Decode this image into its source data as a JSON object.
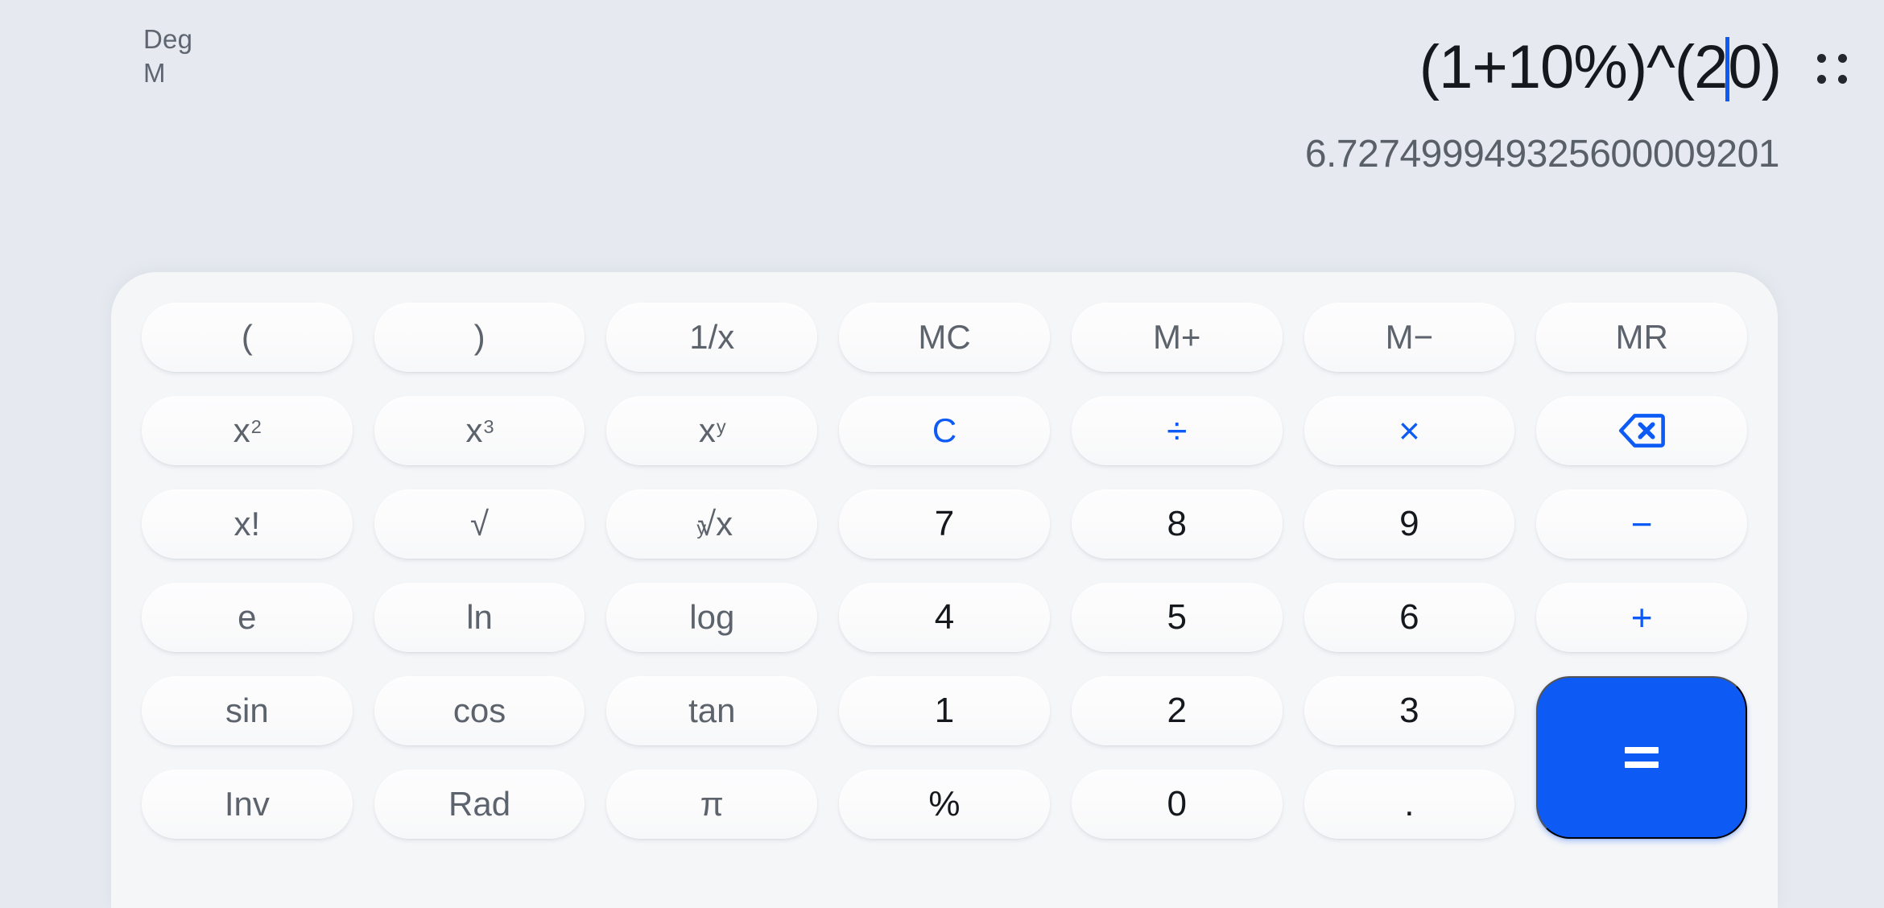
{
  "display": {
    "mode_indicators": [
      {
        "name": "angle-mode",
        "label": "Deg"
      },
      {
        "name": "memory-indicator",
        "label": "M"
      }
    ],
    "expression": "(1+10%)^(20)",
    "expression_before_cursor": "(1+10%)^(2",
    "expression_after_cursor": "0)",
    "cursor_visible": true,
    "result": "6.727499949325600009201",
    "grip_icon": "drag-grip-icon"
  },
  "colors": {
    "background": "#e6eaf0",
    "keypad_panel": "#f5f6f8",
    "accent": "#0d5af5",
    "key_face": "#fbfbfc",
    "key_text": "#5d636c",
    "digit_text": "#15181c",
    "result_text": "#5a6068"
  },
  "keypad": {
    "rows": [
      [
        {
          "name": "key-open-paren",
          "label": "(",
          "type": "function"
        },
        {
          "name": "key-close-paren",
          "label": ")",
          "type": "function"
        },
        {
          "name": "key-reciprocal",
          "label": "1/x",
          "type": "function"
        },
        {
          "name": "key-memory-clear",
          "label": "MC",
          "type": "function"
        },
        {
          "name": "key-memory-add",
          "label": "M+",
          "type": "function"
        },
        {
          "name": "key-memory-subtract",
          "label": "M−",
          "type": "function"
        },
        {
          "name": "key-memory-recall",
          "label": "MR",
          "type": "function"
        }
      ],
      [
        {
          "name": "key-square",
          "label": "x²",
          "type": "function"
        },
        {
          "name": "key-cube",
          "label": "x³",
          "type": "function"
        },
        {
          "name": "key-power",
          "label": "xʸ",
          "type": "function"
        },
        {
          "name": "key-clear",
          "label": "C",
          "type": "accent"
        },
        {
          "name": "key-divide",
          "label": "÷",
          "type": "accent-op"
        },
        {
          "name": "key-multiply",
          "label": "×",
          "type": "accent-op"
        },
        {
          "name": "key-backspace",
          "label": "",
          "type": "icon",
          "icon": "backspace-icon"
        }
      ],
      [
        {
          "name": "key-factorial",
          "label": "x!",
          "type": "function"
        },
        {
          "name": "key-square-root",
          "label": "√",
          "type": "function"
        },
        {
          "name": "key-nth-root",
          "label": "ʸ√x",
          "type": "function"
        },
        {
          "name": "key-7",
          "label": "7",
          "type": "digit"
        },
        {
          "name": "key-8",
          "label": "8",
          "type": "digit"
        },
        {
          "name": "key-9",
          "label": "9",
          "type": "digit"
        },
        {
          "name": "key-subtract",
          "label": "−",
          "type": "accent-op"
        }
      ],
      [
        {
          "name": "key-euler",
          "label": "e",
          "type": "function"
        },
        {
          "name": "key-natural-log",
          "label": "ln",
          "type": "function"
        },
        {
          "name": "key-log",
          "label": "log",
          "type": "function"
        },
        {
          "name": "key-4",
          "label": "4",
          "type": "digit"
        },
        {
          "name": "key-5",
          "label": "5",
          "type": "digit"
        },
        {
          "name": "key-6",
          "label": "6",
          "type": "digit"
        },
        {
          "name": "key-add",
          "label": "+",
          "type": "accent-op"
        }
      ],
      [
        {
          "name": "key-sin",
          "label": "sin",
          "type": "function"
        },
        {
          "name": "key-cos",
          "label": "cos",
          "type": "function"
        },
        {
          "name": "key-tan",
          "label": "tan",
          "type": "function"
        },
        {
          "name": "key-1",
          "label": "1",
          "type": "digit"
        },
        {
          "name": "key-2",
          "label": "2",
          "type": "digit"
        },
        {
          "name": "key-3",
          "label": "3",
          "type": "digit"
        }
      ],
      [
        {
          "name": "key-inverse",
          "label": "Inv",
          "type": "function"
        },
        {
          "name": "key-radian",
          "label": "Rad",
          "type": "function"
        },
        {
          "name": "key-pi",
          "label": "π",
          "type": "function"
        },
        {
          "name": "key-percent",
          "label": "%",
          "type": "digit"
        },
        {
          "name": "key-0",
          "label": "0",
          "type": "digit"
        },
        {
          "name": "key-decimal",
          "label": ".",
          "type": "digit"
        }
      ]
    ],
    "equals": {
      "name": "key-equals",
      "label": "=",
      "type": "accent-filled"
    }
  }
}
